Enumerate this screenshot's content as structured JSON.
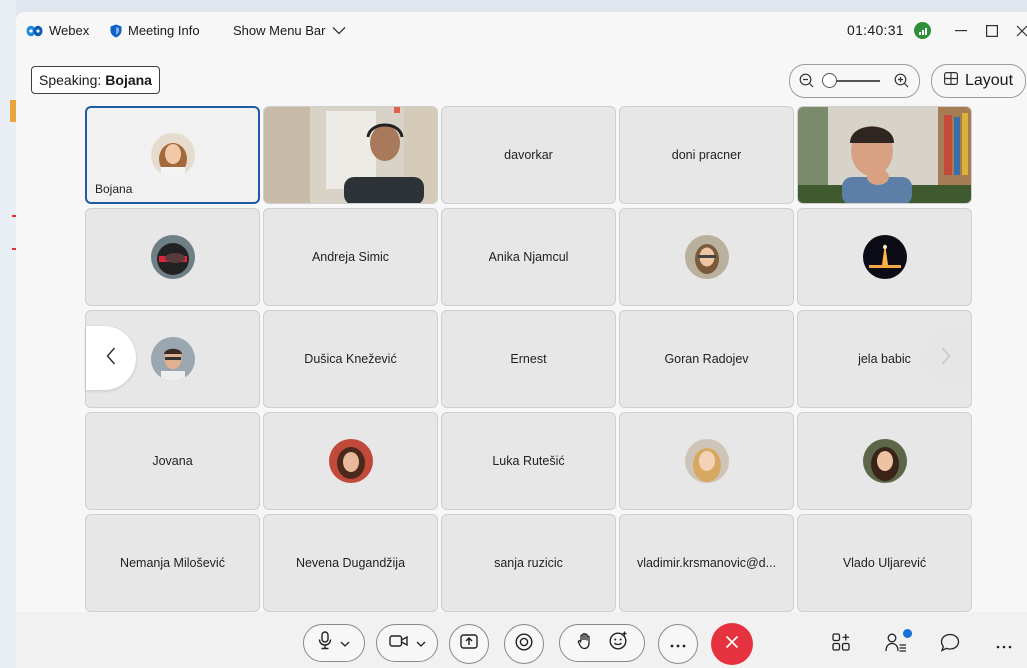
{
  "titlebar": {
    "app_name": "Webex",
    "meeting_info_label": "Meeting Info",
    "show_menu_bar_label": "Show Menu Bar",
    "timer": "01:40:31"
  },
  "speaking": {
    "prefix": "Speaking:",
    "name": "Bojana"
  },
  "view": {
    "layout_label": "Layout"
  },
  "participants": [
    {
      "name": "Bojana",
      "type": "avatar",
      "active": true,
      "label_position": "corner"
    },
    {
      "name": "",
      "type": "video"
    },
    {
      "name": "davorkar",
      "type": "name"
    },
    {
      "name": "doni pracner",
      "type": "name"
    },
    {
      "name": "",
      "type": "video"
    },
    {
      "name": "",
      "type": "avatar"
    },
    {
      "name": "Andreja Simic",
      "type": "name"
    },
    {
      "name": "Anika Njamcul",
      "type": "name"
    },
    {
      "name": "",
      "type": "avatar"
    },
    {
      "name": "",
      "type": "avatar"
    },
    {
      "name": "",
      "type": "avatar"
    },
    {
      "name": "Dušica Knežević",
      "type": "name"
    },
    {
      "name": "Ernest",
      "type": "name"
    },
    {
      "name": "Goran Radojev",
      "type": "name"
    },
    {
      "name": "jela babic",
      "type": "name"
    },
    {
      "name": "Jovana",
      "type": "name"
    },
    {
      "name": "",
      "type": "avatar"
    },
    {
      "name": "Luka Rutešić",
      "type": "name"
    },
    {
      "name": "",
      "type": "avatar"
    },
    {
      "name": "",
      "type": "avatar"
    },
    {
      "name": "Nemanja Milošević",
      "type": "name"
    },
    {
      "name": "Nevena Dugandžija",
      "type": "name"
    },
    {
      "name": "sanja ruzicic",
      "type": "name"
    },
    {
      "name": "vladimir.krsmanovic@d...",
      "type": "name"
    },
    {
      "name": "Vlado Uljarević",
      "type": "name"
    }
  ],
  "colors": {
    "active_border": "#1f5aa6",
    "end_call": "#e5323e",
    "signal": "#2f8f3a",
    "badge": "#1670d8"
  },
  "icons": {
    "app": "webex-logo-icon",
    "meeting_info": "shield-icon",
    "mute": "microphone-icon",
    "video": "camera-icon",
    "share": "share-screen-icon",
    "record": "record-icon",
    "raise_hand": "hand-icon",
    "reactions": "emoji-icon",
    "more": "ellipsis-icon",
    "end": "close-icon",
    "apps": "apps-icon",
    "participants": "participants-icon",
    "chat": "chat-icon"
  }
}
